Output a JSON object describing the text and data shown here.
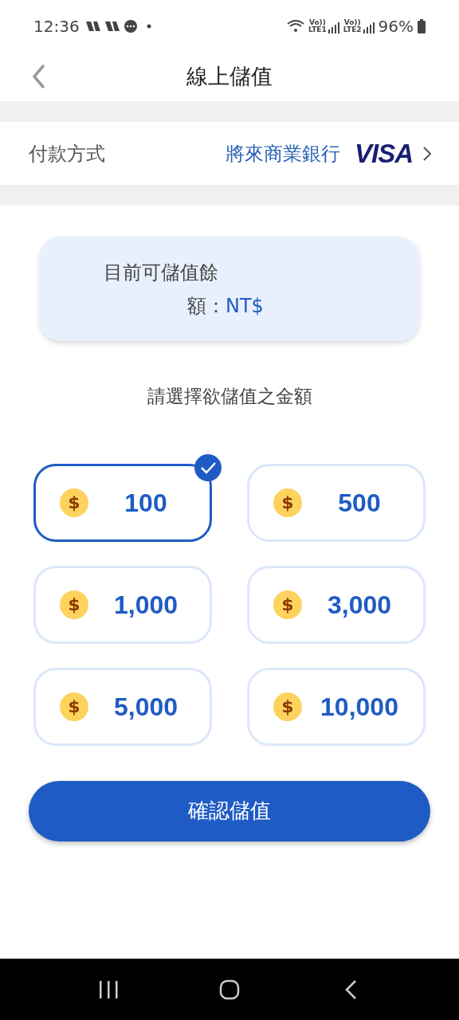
{
  "status_bar": {
    "time": "12:36",
    "sim1": {
      "volte": "Vo))",
      "network": "LTE1"
    },
    "sim2": {
      "volte": "Vo))",
      "network": "LTE2"
    },
    "battery": "96%"
  },
  "header": {
    "title": "線上儲值"
  },
  "payment": {
    "label": "付款方式",
    "bank": "將來商業銀行",
    "card_brand": "VISA"
  },
  "balance": {
    "label": "目前可儲值餘",
    "label_rest": "額：",
    "currency": "NT$"
  },
  "prompt": "請選擇欲儲值之金額",
  "amounts": [
    {
      "value": "100",
      "symbol": "$",
      "selected": true
    },
    {
      "value": "500",
      "symbol": "$",
      "selected": false
    },
    {
      "value": "1,000",
      "symbol": "$",
      "selected": false
    },
    {
      "value": "3,000",
      "symbol": "$",
      "selected": false
    },
    {
      "value": "5,000",
      "symbol": "$",
      "selected": false
    },
    {
      "value": "10,000",
      "symbol": "$",
      "selected": false
    }
  ],
  "confirm_button": "確認儲值"
}
